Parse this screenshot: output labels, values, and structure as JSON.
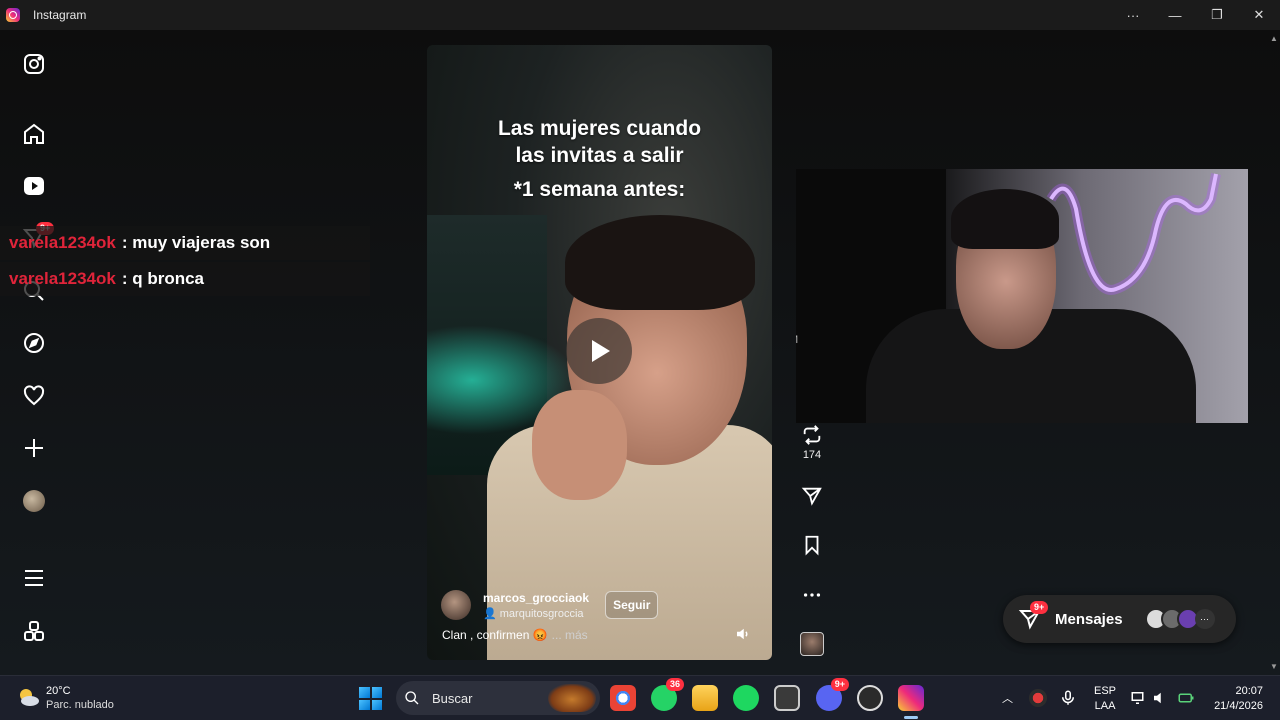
{
  "window": {
    "title": "Instagram",
    "controls": {
      "more": "···",
      "minimize": "—",
      "restore": "❐",
      "close": "✕"
    }
  },
  "sidebar": {
    "items": [
      {
        "name": "instagram-logo-icon"
      },
      {
        "name": "home-icon"
      },
      {
        "name": "reels-icon"
      },
      {
        "name": "direct-icon",
        "badge": "9+"
      },
      {
        "name": "search-icon"
      },
      {
        "name": "explore-icon"
      },
      {
        "name": "notifications-icon"
      },
      {
        "name": "create-icon"
      },
      {
        "name": "profile-avatar"
      },
      {
        "name": "menu-icon"
      },
      {
        "name": "also-from-meta-icon"
      }
    ]
  },
  "chat_overlay": [
    {
      "user": "varela1234ok",
      "message": ": muy viajeras son"
    },
    {
      "user": "varela1234ok",
      "message": ": q bronca"
    }
  ],
  "reel": {
    "caption_lines": [
      "Las mujeres cuando",
      "las invitas a salir",
      "*1 semana antes:"
    ],
    "author": "marcos_grocciaok",
    "audio": "marquitosgroccia",
    "follow_label": "Seguir",
    "description": "Clan , confirmen 😡",
    "more_label": "... más"
  },
  "reel_actions": {
    "repost_count": "174"
  },
  "webcam": {
    "edge_letter": "M"
  },
  "messages": {
    "label": "Mensajes",
    "badge": "9+"
  },
  "taskbar": {
    "weather_temp": "20°C",
    "weather_condition": "Parc. nublado",
    "search_label": "Buscar",
    "whatsapp_badge": "36",
    "discord_badge": "9+",
    "lang_line1": "ESP",
    "lang_line2": "LAA",
    "time": "20:07",
    "date": "21/4/2026"
  },
  "colors": {
    "chat_user": "#e0243a",
    "badge": "#ff3040",
    "taskbar_bg": "#1c1f2b"
  }
}
